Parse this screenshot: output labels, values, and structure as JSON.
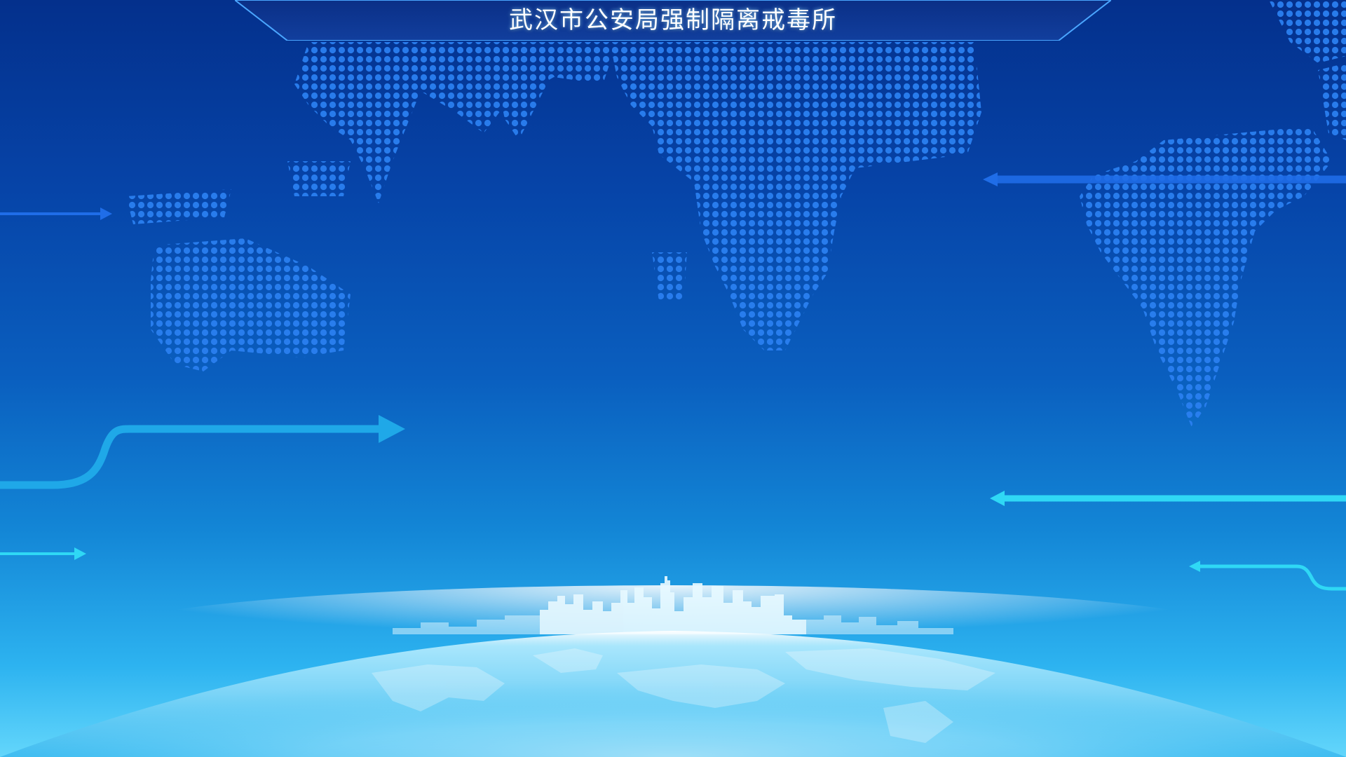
{
  "header": {
    "title": "武汉市公安局强制隔离戒毒所"
  },
  "decor": {
    "icons": [
      "world-dot-map",
      "flow-arrow",
      "city-skyline",
      "globe"
    ],
    "colors": {
      "top": "#04308c",
      "bottom": "#63d6fb",
      "dot": "#2a7ff0",
      "arrow_blue": "#1f6de8",
      "arrow_cyan": "#2fd8f5",
      "skyline": "#e6f8ff"
    }
  }
}
